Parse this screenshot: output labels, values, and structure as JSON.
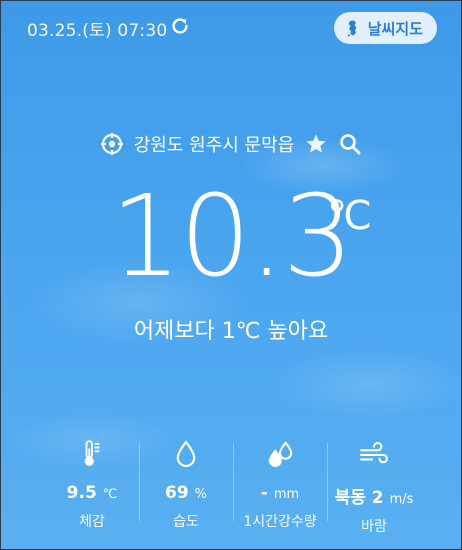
{
  "header": {
    "datetime": "03.25.(토) 07:30",
    "weather_map_label": "날씨지도"
  },
  "location": {
    "name": "강원도 원주시 문막읍"
  },
  "current": {
    "temperature": "10.3",
    "unit": "℃",
    "comparison": "어제보다 1℃ 높아요"
  },
  "stats": [
    {
      "icon": "thermometer-icon",
      "value": "9.5",
      "unit": "℃",
      "label": "체감"
    },
    {
      "icon": "humidity-drop-icon",
      "value": "69",
      "unit": "%",
      "label": "습도"
    },
    {
      "icon": "precipitation-icon",
      "value": "-",
      "unit": "mm",
      "label": "1시간강수량"
    },
    {
      "icon": "wind-icon",
      "value": "북동 2",
      "unit": "m/s",
      "label": "바람"
    }
  ],
  "colors": {
    "background_top": "#3e9ae8",
    "background_bottom": "#59b0f1",
    "map_button_text": "#2b7ed8"
  }
}
